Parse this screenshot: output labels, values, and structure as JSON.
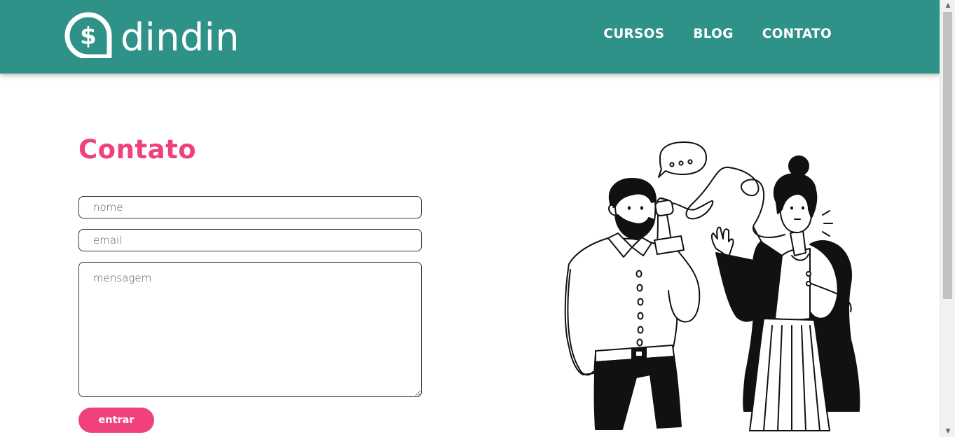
{
  "brand": {
    "name": "dindin",
    "logo_icon": "dollar-speech-bubble-icon"
  },
  "nav": {
    "items": [
      {
        "label": "CURSOS"
      },
      {
        "label": "BLOG"
      },
      {
        "label": "CONTATO"
      }
    ]
  },
  "contact": {
    "title": "Contato",
    "name_placeholder": "nome",
    "email_placeholder": "email",
    "message_placeholder": "mensagem",
    "submit_label": "entrar"
  },
  "illustration": {
    "icon": "people-talking-tin-can-phone-illustration"
  },
  "colors": {
    "header_bg": "#2f9288",
    "accent_pink": "#f0407e",
    "white": "#ffffff"
  }
}
